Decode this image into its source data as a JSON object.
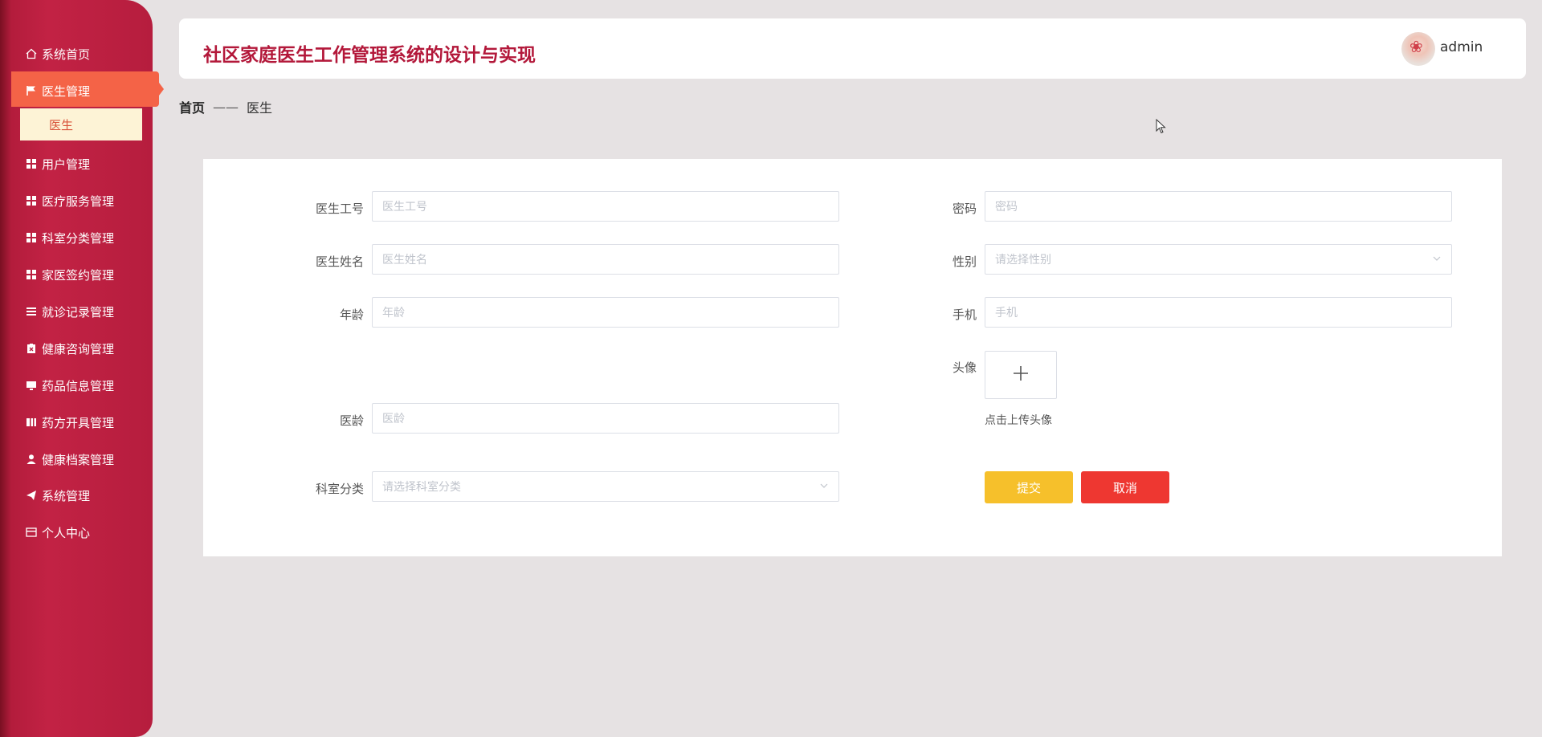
{
  "app": {
    "title": "社区家庭医生工作管理系统的设计与实现",
    "username": "admin"
  },
  "sidebar": {
    "items": [
      {
        "label": "系统首页",
        "icon": "home-icon"
      },
      {
        "label": "医生管理",
        "icon": "flag-icon"
      },
      {
        "label": "用户管理",
        "icon": "grid-icon"
      },
      {
        "label": "医疗服务管理",
        "icon": "grid-icon"
      },
      {
        "label": "科室分类管理",
        "icon": "grid-icon"
      },
      {
        "label": "家医签约管理",
        "icon": "grid-icon"
      },
      {
        "label": "就诊记录管理",
        "icon": "list-icon"
      },
      {
        "label": "健康咨询管理",
        "icon": "clipboard-icon"
      },
      {
        "label": "药品信息管理",
        "icon": "monitor-icon"
      },
      {
        "label": "药方开具管理",
        "icon": "book-icon"
      },
      {
        "label": "健康档案管理",
        "icon": "user-icon"
      },
      {
        "label": "系统管理",
        "icon": "send-icon"
      },
      {
        "label": "个人中心",
        "icon": "card-icon"
      }
    ],
    "submenu": "医生",
    "active_color": "#f46347"
  },
  "breadcrumb": {
    "home": "首页",
    "separator": "——",
    "current": "医生"
  },
  "form": {
    "doctor_id": {
      "label": "医生工号",
      "placeholder": "医生工号"
    },
    "password": {
      "label": "密码",
      "placeholder": "密码"
    },
    "doctor_name": {
      "label": "医生姓名",
      "placeholder": "医生姓名"
    },
    "gender": {
      "label": "性别",
      "placeholder": "请选择性别"
    },
    "age": {
      "label": "年龄",
      "placeholder": "年龄"
    },
    "phone": {
      "label": "手机",
      "placeholder": "手机"
    },
    "avatar": {
      "label": "头像",
      "tip": "点击上传头像"
    },
    "seniority": {
      "label": "医龄",
      "placeholder": "医龄"
    },
    "department": {
      "label": "科室分类",
      "placeholder": "请选择科室分类"
    },
    "submit": "提交",
    "cancel": "取消"
  },
  "colors": {
    "brand": "#b3183a",
    "submit": "#f6c02b",
    "cancel": "#ee3731"
  }
}
